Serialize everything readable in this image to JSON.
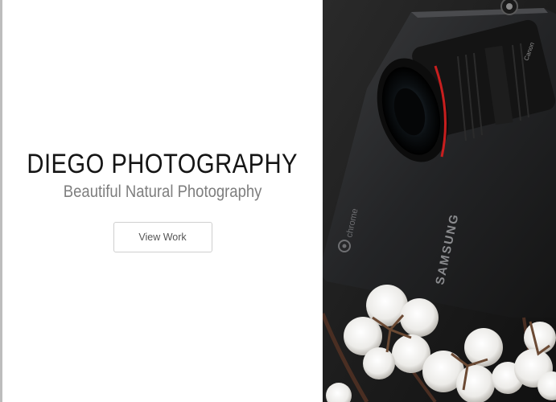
{
  "hero": {
    "title": "DIEGO PHOTOGRAPHY",
    "subtitle": "Beautiful Natural Photography",
    "button_label": "View Work"
  },
  "photo": {
    "laptop_logo_text": "chrome",
    "laptop_brand_text": "SAMSUNG",
    "lens_brand_text": "Canon"
  },
  "colors": {
    "title": "#151515",
    "subtitle": "#7e7e7e",
    "photo_background": "#1a1a1a",
    "lens_accent": "#c81e1e"
  }
}
